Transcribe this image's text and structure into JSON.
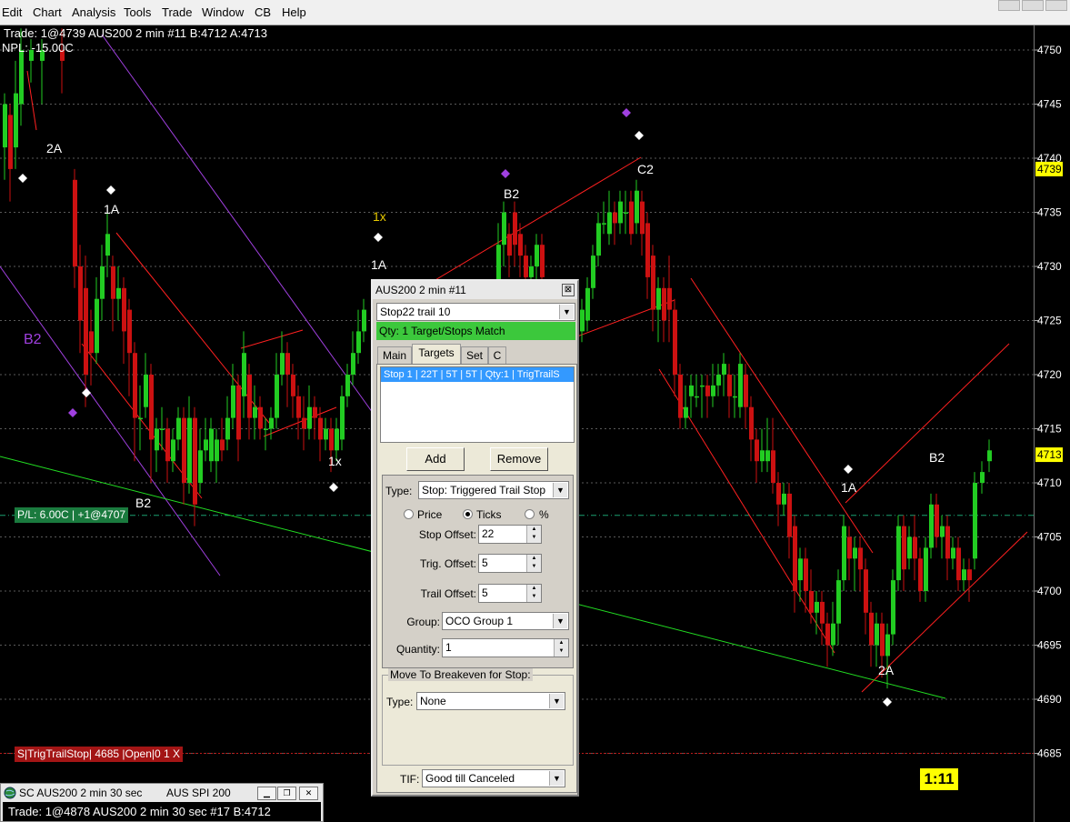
{
  "menu": [
    "Edit",
    "Chart",
    "Analysis",
    "Tools",
    "Trade",
    "Window",
    "CB",
    "Help"
  ],
  "chart_info": {
    "line1": "Trade: 1@4739 AUS200  2 min  #11 B:4712 A:4713",
    "line2": "NPL: -15.00C"
  },
  "price_axis": {
    "ticks": [
      "4750",
      "4745",
      "4740",
      "4735",
      "4730",
      "4725",
      "4720",
      "4715",
      "4710",
      "4705",
      "4700",
      "4695",
      "4690",
      "4685"
    ],
    "current_trade": "4739",
    "current_price": "4713"
  },
  "annotations": [
    {
      "text": "2A",
      "color": "#ffffff"
    },
    {
      "text": "1A",
      "color": "#ffffff"
    },
    {
      "text": "B2",
      "color": "#a040e0"
    },
    {
      "text": "B2",
      "color": "#ffffff"
    },
    {
      "text": "1x",
      "color": "#e6c800"
    },
    {
      "text": "1A",
      "color": "#ffffff"
    },
    {
      "text": "1x",
      "color": "#ffffff"
    },
    {
      "text": "B2",
      "color": "#ffffff"
    },
    {
      "text": "C2",
      "color": "#ffffff"
    },
    {
      "text": "1A",
      "color": "#ffffff"
    },
    {
      "text": "B2",
      "color": "#ffffff"
    },
    {
      "text": "2A",
      "color": "#ffffff"
    }
  ],
  "position_label": "P/L: 6.00C | +1@4707",
  "stop_label": "S|TrigTrailStop| 4685 |Open|0  1   X",
  "timer": "1:11",
  "colors": {
    "up_candle": "#22cc22",
    "down_candle": "#cc1111",
    "channel": "#ff2020",
    "trend": "#22dd22",
    "purple": "#a040e0"
  },
  "dialog": {
    "title": "AUS200  2 min   #11",
    "close": "⊠",
    "strategy": "Stop22 trail 10",
    "status": "Qty: 1 Target/Stops Match",
    "tabs": [
      "Main",
      "Targets",
      "Set",
      "C"
    ],
    "list_item": "Stop 1 | 22T | 5T | 5T | Qty:1 | TrigTrailS",
    "add": "Add",
    "remove": "Remove",
    "type_label": "Type:",
    "type_value": "Stop: Triggered Trail Stop",
    "radio_price": "Price",
    "radio_ticks": "Ticks",
    "radio_pct": "%",
    "stop_offset_label": "Stop Offset:",
    "stop_offset": "22",
    "trig_offset_label": "Trig. Offset:",
    "trig_offset": "5",
    "trail_offset_label": "Trail Offset:",
    "trail_offset": "5",
    "group_label": "Group:",
    "group_value": "OCO Group 1",
    "quantity_label": "Quantity:",
    "quantity": "1",
    "breakeven_title": "Move To Breakeven for Stop:",
    "be_type_label": "Type:",
    "be_type_value": "None",
    "tif_label": "TIF:",
    "tif_value": "Good till Canceled"
  },
  "mini_window": {
    "title": "SC AUS200  2 min 30 sec",
    "title2": "AUS SPI 200",
    "body": "Trade: 1@4878 AUS200  2 min 30 sec   #17 B:4712"
  }
}
